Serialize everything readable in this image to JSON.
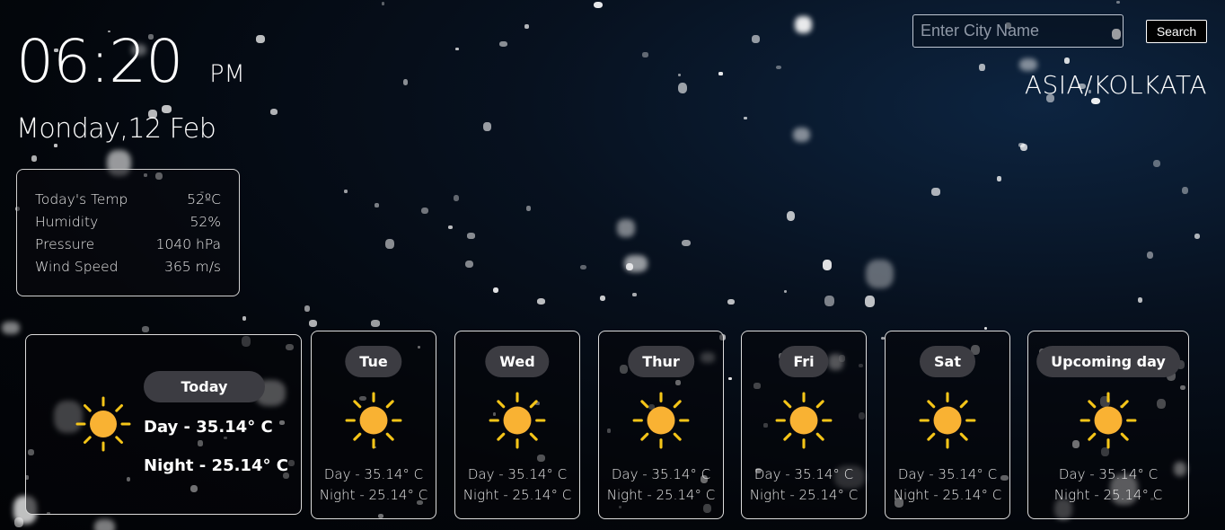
{
  "clock": {
    "time": "06:20",
    "ampm": "PM"
  },
  "date": "Monday,12 Feb",
  "current": {
    "rows": [
      {
        "label": "Today's Temp",
        "value": "52ºC"
      },
      {
        "label": "Humidity",
        "value": "52%"
      },
      {
        "label": "Pressure",
        "value": "1040 hPa"
      },
      {
        "label": "Wind Speed",
        "value": "365 m/s"
      }
    ]
  },
  "search": {
    "placeholder": "Enter City Name",
    "button_label": "Search"
  },
  "timezone": "ASIA/KOLKATA",
  "today": {
    "label": "Today",
    "day": "Day - 35.14° C",
    "night": "Night - 25.14° C",
    "icon": "sun-icon"
  },
  "forecast": [
    {
      "label": "Tue",
      "day": "Day - 35.14° C",
      "night": "Night - 25.14° C",
      "icon": "sun-icon"
    },
    {
      "label": "Wed",
      "day": "Day - 35.14° C",
      "night": "Night - 25.14° C",
      "icon": "sun-icon"
    },
    {
      "label": "Thur",
      "day": "Day - 35.14° C",
      "night": "Night - 25.14° C",
      "icon": "sun-icon"
    },
    {
      "label": "Fri",
      "day": "Day - 35.14° C",
      "night": "Night - 25.14° C",
      "icon": "sun-icon"
    },
    {
      "label": "Sat",
      "day": "Day - 35.14° C",
      "night": "Night - 25.14° C",
      "icon": "sun-icon"
    },
    {
      "label": "Upcoming day",
      "day": "Day - 35.14° C",
      "night": "Night - 25.14° C",
      "icon": "sun-icon"
    }
  ],
  "colors": {
    "sun": "#f9b233",
    "rays": "#f5c518",
    "pill": "#3c3c42"
  }
}
